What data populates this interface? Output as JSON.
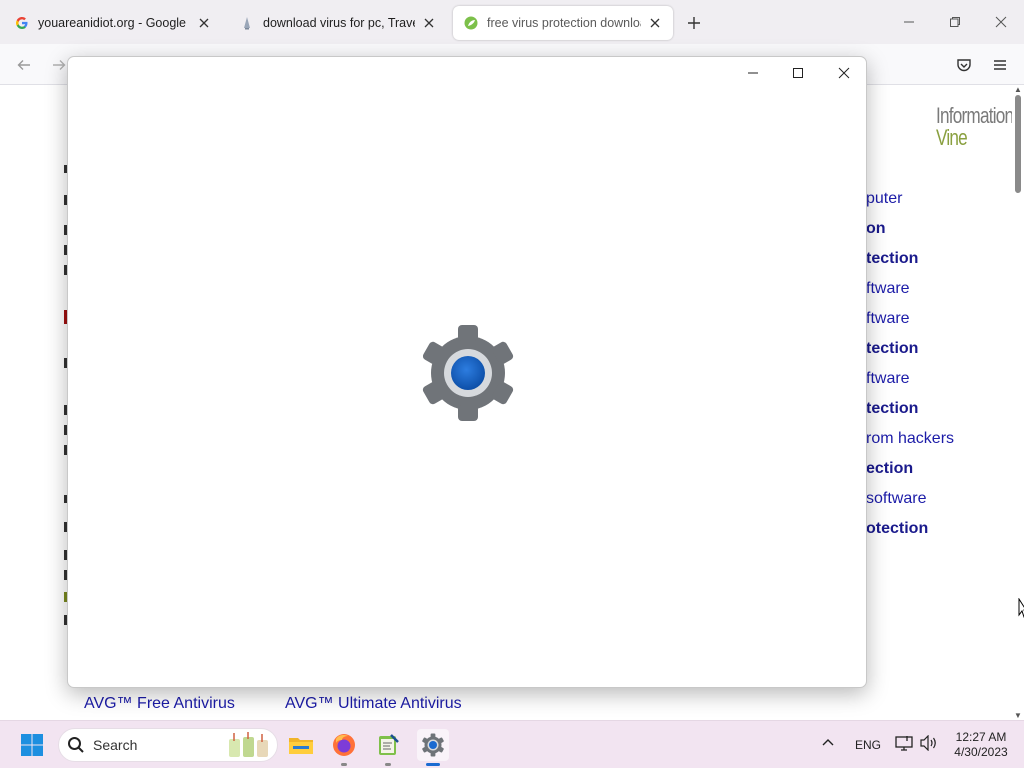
{
  "browser": {
    "tabs": [
      {
        "title": "youareanidiot.org - Google Search",
        "favicon": "google-g-icon"
      },
      {
        "title": "download virus for pc, Travelsearch",
        "favicon": "travelsearch-icon"
      },
      {
        "title": "free virus protection download",
        "favicon": "leaf-icon",
        "active": true
      }
    ],
    "window_controls": [
      "minimize",
      "restore",
      "close"
    ]
  },
  "page": {
    "brand": {
      "line1": "Information",
      "line2": "Vine"
    },
    "related_links": [
      {
        "text": "puter",
        "bold": false
      },
      {
        "text": "on",
        "bold": true
      },
      {
        "text": "tection",
        "bold": true
      },
      {
        "text": "ftware",
        "bold": false
      },
      {
        "text": "ftware",
        "bold": false
      },
      {
        "text": "tection",
        "bold": true
      },
      {
        "text": "ftware",
        "bold": false
      },
      {
        "text": "tection",
        "bold": true
      },
      {
        "text": "rom hackers",
        "bold": false
      },
      {
        "text": "ection",
        "bold": true
      },
      {
        "text": " software",
        "bold": false
      },
      {
        "text": "otection",
        "bold": true
      }
    ],
    "bottom_links": [
      "AVG™ Free Antivirus",
      "AVG™ Ultimate Antivirus"
    ]
  },
  "app_window": {
    "icon": "settings-gear-icon",
    "controls": [
      "minimize",
      "maximize",
      "close"
    ]
  },
  "taskbar": {
    "search_label": "Search",
    "apps": [
      "start-icon",
      "file-explorer-icon",
      "firefox-icon",
      "notepad-icon",
      "settings-icon"
    ],
    "language": "ENG",
    "time": "12:27 AM",
    "date": "4/30/2023"
  },
  "colors": {
    "link": "#1c1ca8",
    "brand_green": "#8aa040",
    "accent": "#1a6ad1"
  }
}
